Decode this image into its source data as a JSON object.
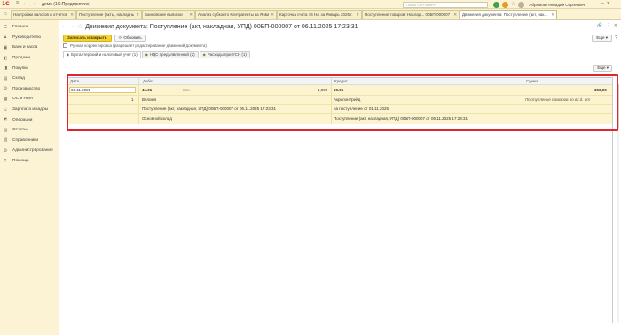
{
  "titlebar": {
    "logo": "1С",
    "app_title": "демо  (1С:Предприятие)",
    "search_placeholder": "Поиск Ctrl+Shift+F",
    "user_name": "Абрамов Геннадий Сергеевич"
  },
  "tabs": [
    {
      "label": "Настройки налогов и отчетов"
    },
    {
      "label": "Поступление (акты, накладные, УПД)"
    },
    {
      "label": "Банковские выписки"
    },
    {
      "label": "Анализ субконто Контрагенты за Январь 20..."
    },
    {
      "label": "Карточка счета 76 НА за Январь 2026 г. ..."
    },
    {
      "label": "Поступление товаров: Наклад... 00БП-000007"
    },
    {
      "label": "Движения документа: Поступление (акт, нак..."
    }
  ],
  "sidebar": {
    "items": [
      {
        "label": "Главное",
        "icon": "☰"
      },
      {
        "label": "Руководителю",
        "icon": "▲"
      },
      {
        "label": "Банк и касса",
        "icon": "▣"
      },
      {
        "label": "Продажи",
        "icon": "◧"
      },
      {
        "label": "Покупки",
        "icon": "◨"
      },
      {
        "label": "Склад",
        "icon": "▤"
      },
      {
        "label": "Производство",
        "icon": "⚙"
      },
      {
        "label": "ОС и НМА",
        "icon": "▦"
      },
      {
        "label": "Зарплата и кадры",
        "icon": "☺"
      },
      {
        "label": "Операции",
        "icon": "◩"
      },
      {
        "label": "Отчеты",
        "icon": "▥"
      },
      {
        "label": "Справочники",
        "icon": "▧"
      },
      {
        "label": "Администрирование",
        "icon": "⚙"
      },
      {
        "label": "Помощь",
        "icon": "?"
      }
    ]
  },
  "document": {
    "title": "Движения документа: Поступление (акт, накладная, УПД) 00БП-000007 от 06.11.2025 17:23:31",
    "save_close_label": "Записать и закрыть",
    "refresh_label": "Обновить",
    "more_label": "Еще ▾",
    "help_label": "?",
    "checkbox_label": "Ручная корректировка (разрешает редактирование движений документа)",
    "subtabs": [
      {
        "label": "Бухгалтерский и налоговый учет (1)"
      },
      {
        "label": "НДС предъявленный (2)"
      },
      {
        "label": "Расходы при УСН (1)"
      }
    ],
    "more2_label": "Еще ▾"
  },
  "table": {
    "headers": {
      "date": "Дата",
      "debit": "Дебет",
      "credit": "Кредит",
      "sum": "Сумма"
    },
    "row": {
      "date": "06.11.2025",
      "number": "1",
      "debit_account": "41.01",
      "debit_qty_label": "Кол.",
      "debit_qty": "1,000",
      "credit_account": "60.01",
      "sum": "350,00",
      "debit_sub1": "Веломя",
      "debit_sub2": "Поступление (акт, накладная, УПД) 00БП-000007 от 06.11.2025 17:23:31",
      "debit_sub3": "Основной склад",
      "credit_sub1": "АкрилонТрейд",
      "credit_sub2": "на поступление от 01.11.2025",
      "credit_sub3": "Поступление (акт, накладная, УПД) 00БП-000007 от 06.11.2025 17:23:31",
      "content": "Поступление товаров по вх.д. от"
    }
  }
}
